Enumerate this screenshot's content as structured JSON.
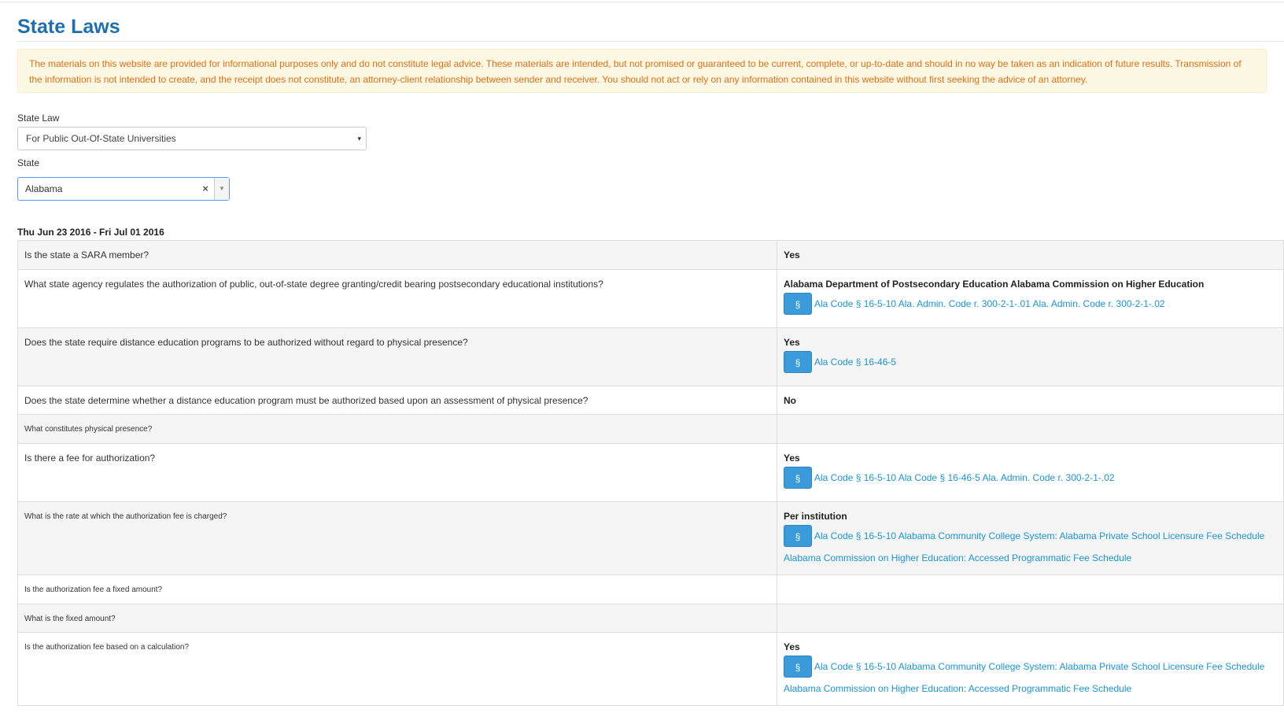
{
  "page": {
    "title": "State Laws"
  },
  "disclaimer": "The materials on this website are provided for informational purposes only and do not constitute legal advice. These materials are intended, but not promised or guaranteed to be current, complete, or up-to-date and should in no way be taken as an indication of future results. Transmission of the information is not intended to create, and the receipt does not constitute, an attorney-client relationship between sender and receiver. You should not act or rely on any information contained in this website without first seeking the advice of an attorney.",
  "filters": {
    "state_law_label": "State Law",
    "state_law_value": "For Public Out-Of-State Universities",
    "state_label": "State",
    "state_value": "Alabama",
    "clear_glyph": "×",
    "caret_glyph": "▾",
    "arrow_glyph": "▼"
  },
  "date_range": "Thu Jun 23 2016 - Fri Jul 01 2016",
  "law_button_glyph": "§",
  "rows": [
    {
      "question": "Is the state a SARA member?",
      "answer": "Yes",
      "refs": []
    },
    {
      "question": "What state agency regulates the authorization of public, out-of-state degree granting/credit bearing postsecondary educational institutions?",
      "answer": "Alabama Department of Postsecondary Education Alabama Commission on Higher Education",
      "refs": [
        "Ala Code § 16-5-10 Ala. Admin. Code r. 300-2-1-.01 Ala. Admin. Code r. 300-2-1-.02"
      ]
    },
    {
      "question": "Does the state require distance education programs to be authorized without regard to physical presence?",
      "answer": "Yes",
      "refs": [
        "Ala Code § 16-46-5"
      ]
    },
    {
      "question": "Does the state determine whether a distance education program must be authorized based upon an assessment of physical presence?",
      "answer": "No",
      "refs": []
    },
    {
      "question": "What constitutes physical presence?",
      "answer": "",
      "refs": []
    },
    {
      "question": "Is there a fee for authorization?",
      "answer": "Yes",
      "refs": [
        "Ala Code § 16-5-10 Ala Code § 16-46-5 Ala. Admin. Code r. 300-2-1-.02"
      ]
    },
    {
      "question": "What is the rate at which the authorization fee is charged?",
      "answer": "Per institution",
      "refs": [
        "Ala Code § 16-5-10 Alabama Community College System: Alabama Private School Licensure Fee Schedule",
        "Alabama Commission on Higher Education: Accessed Programmatic Fee Schedule"
      ]
    },
    {
      "question": "Is the authorization fee a fixed amount?",
      "answer": "",
      "refs": []
    },
    {
      "question": "What is the fixed amount?",
      "answer": "",
      "refs": []
    },
    {
      "question": "Is the authorization fee based on a calculation?",
      "answer": "Yes",
      "refs": [
        "Ala Code § 16-5-10 Alabama Community College System: Alabama Private School Licensure Fee Schedule",
        "Alabama Commission on Higher Education: Accessed Programmatic Fee Schedule"
      ]
    }
  ]
}
